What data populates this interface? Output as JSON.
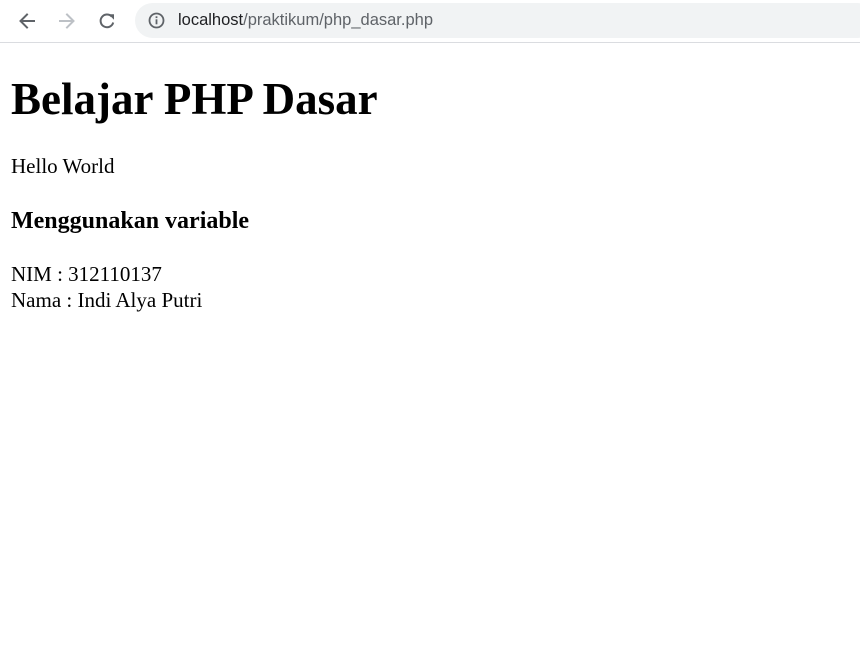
{
  "browser": {
    "url_host": "localhost",
    "url_path": "/praktikum/php_dasar.php",
    "icons": {
      "back": "arrow-left-icon",
      "forward": "arrow-right-icon",
      "reload": "reload-icon",
      "site_info": "info-circle-icon"
    }
  },
  "page": {
    "title": "Belajar PHP Dasar",
    "hello": "Hello World",
    "subtitle": "Menggunakan variable",
    "nim_line": "NIM : 312110137",
    "nama_line": "Nama : Indi Alya Putri"
  },
  "colors": {
    "toolbar_bg": "#ffffff",
    "omnibox_bg": "#f1f3f4",
    "icon_active": "#5f6368",
    "icon_disabled": "#bdc1c6",
    "text": "#000000"
  }
}
